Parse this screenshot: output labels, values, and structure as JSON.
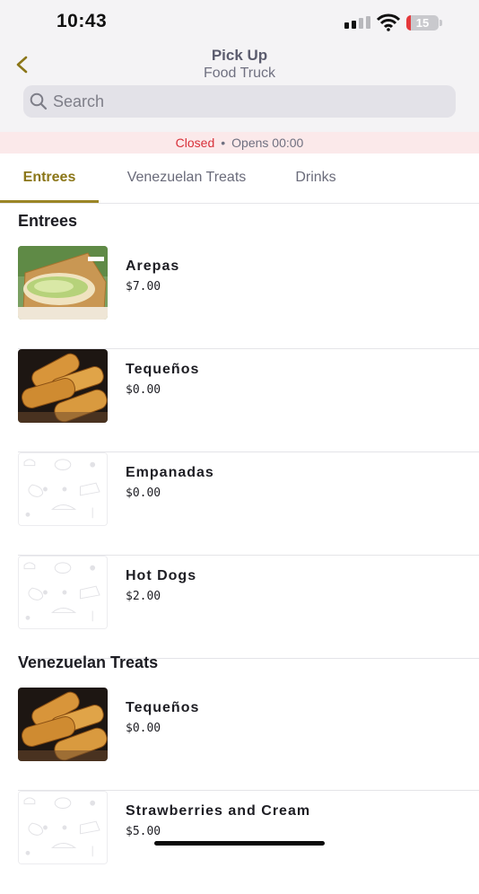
{
  "status_bar": {
    "time": "10:43",
    "battery_level": "15",
    "battery_color": "#e5383b",
    "icons": [
      "cellular-signal-icon",
      "wifi-icon",
      "battery-icon"
    ]
  },
  "header": {
    "back_icon": "chevron-left-icon",
    "title": "Pick Up",
    "subtitle": "Food Truck",
    "accent_color": "#8b7618"
  },
  "search": {
    "placeholder": "Search",
    "value": ""
  },
  "store_status": {
    "state": "Closed",
    "separator": "•",
    "opens": "Opens 00:00",
    "state_color": "#d8313a"
  },
  "tabs": [
    {
      "label": "Entrees",
      "active": true
    },
    {
      "label": "Venezuelan Treats",
      "active": false
    },
    {
      "label": "Drinks",
      "active": false
    }
  ],
  "sections": [
    {
      "title": "Entrees",
      "items": [
        {
          "name": "Arepas",
          "price": "$7.00",
          "image": "arepa-photo"
        },
        {
          "name": "Tequeños",
          "price": "$0.00",
          "image": "tequenos-photo"
        },
        {
          "name": "Empanadas",
          "price": "$0.00",
          "image": "placeholder-food-pattern"
        },
        {
          "name": "Hot Dogs",
          "price": "$2.00",
          "image": "placeholder-food-pattern"
        }
      ]
    },
    {
      "title": "Venezuelan Treats",
      "items": [
        {
          "name": "Tequeños",
          "price": "$0.00",
          "image": "tequenos-photo"
        },
        {
          "name": "Strawberries and Cream",
          "price": "$5.00",
          "image": "placeholder-food-pattern"
        }
      ]
    }
  ]
}
